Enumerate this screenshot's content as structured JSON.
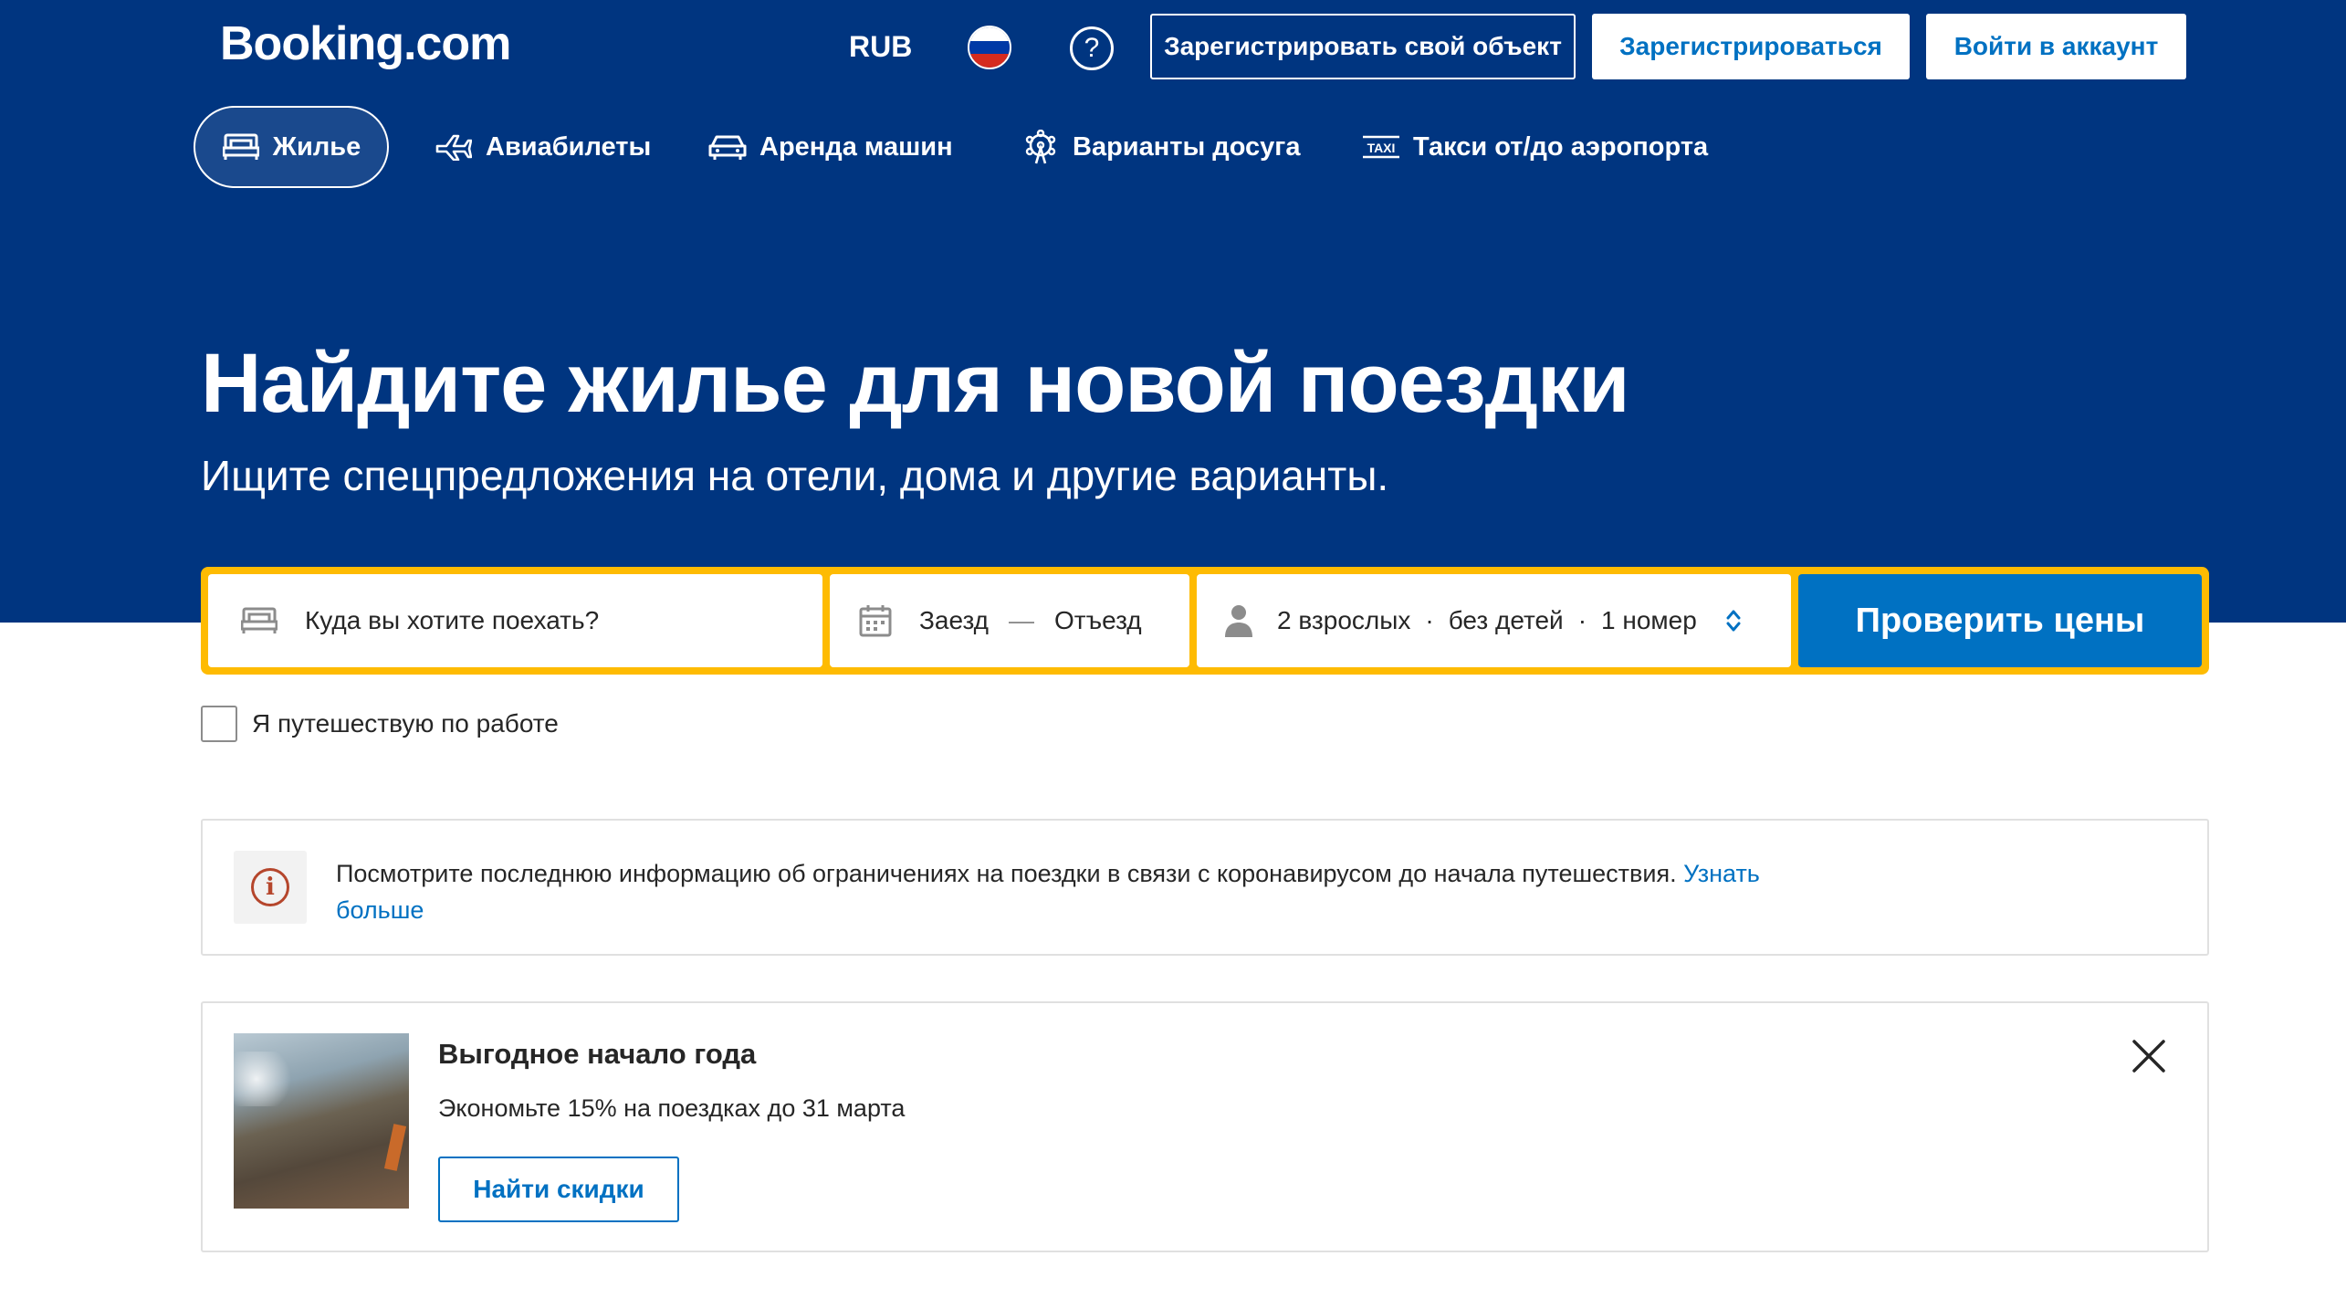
{
  "header": {
    "logo": "Booking.com",
    "currency": "RUB",
    "language_flag": "russia-flag-icon",
    "help_symbol": "?",
    "list_property_label": "Зарегистрировать свой объект",
    "register_label": "Зарегистрироваться",
    "login_label": "Войти в аккаунт"
  },
  "nav": {
    "items": [
      {
        "label": "Жилье",
        "icon": "bed-icon",
        "active": true
      },
      {
        "label": "Авиабилеты",
        "icon": "plane-icon",
        "active": false
      },
      {
        "label": "Аренда машин",
        "icon": "car-icon",
        "active": false
      },
      {
        "label": "Варианты досуга",
        "icon": "ferris-wheel-icon",
        "active": false
      },
      {
        "label": "Такси от/до аэропорта",
        "icon": "taxi-icon",
        "active": false
      }
    ]
  },
  "hero": {
    "title": "Найдите жилье для новой поездки",
    "subtitle": "Ищите спецпредложения на отели, дома и другие варианты."
  },
  "search": {
    "destination_placeholder": "Куда вы хотите поехать?",
    "checkin_label": "Заезд",
    "date_separator": "—",
    "checkout_label": "Отъезд",
    "adults": "2 взрослых",
    "dot": "·",
    "children": "без детей",
    "rooms": "1 номер",
    "submit_label": "Проверить цены",
    "business_trip_label": "Я путешествую по работе"
  },
  "notice": {
    "icon_symbol": "i",
    "text": "Посмотрите последнюю информацию об ограничениях на поездки в связи с коронавирусом до начала путешествия.",
    "link_label": "Узнать больше"
  },
  "promo": {
    "title": "Выгодное начало года",
    "description": "Экономьте 15% на поездках до 31 марта",
    "cta_label": "Найти скидки"
  },
  "colors": {
    "brand_blue": "#003580",
    "action_blue": "#0071c2",
    "search_border": "#febb02"
  }
}
